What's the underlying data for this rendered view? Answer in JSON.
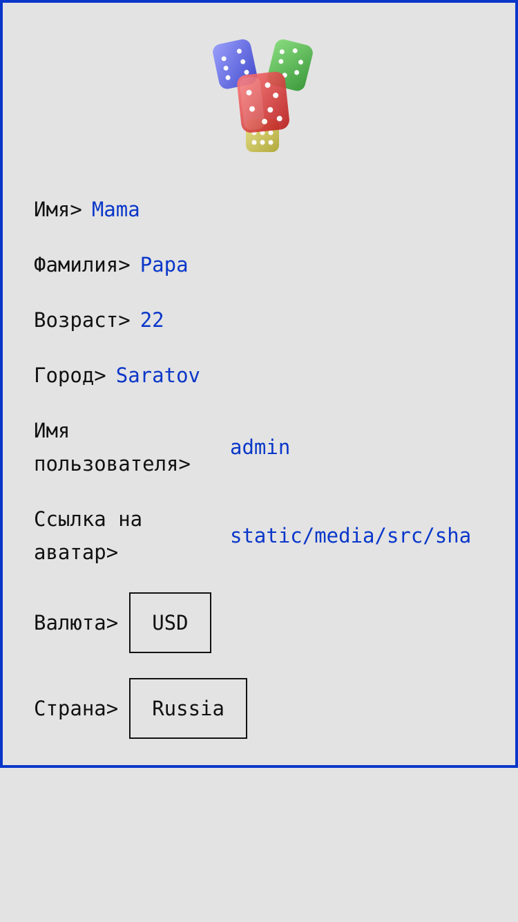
{
  "logo": {
    "icon": "dice-icon"
  },
  "fields": {
    "first_name": {
      "label": "Имя>",
      "value": "Mama"
    },
    "last_name": {
      "label": "Фамилия>",
      "value": "Papa"
    },
    "age": {
      "label": "Возраст>",
      "value": "22"
    },
    "city": {
      "label": "Город>",
      "value": "Saratov"
    },
    "username": {
      "label_line1": "Имя",
      "label_line2": "пользователя>",
      "value": "admin"
    },
    "avatar_link": {
      "label_line1": "Ссылка на",
      "label_line2": "аватар>",
      "value": "static/media/src/sha"
    },
    "currency": {
      "label": "Валюта>",
      "value": "USD"
    },
    "country": {
      "label": "Страна>",
      "value": "Russia"
    }
  },
  "colors": {
    "border": "#0a37c9",
    "value_text": "#0a37c9",
    "background": "#e3e3e3"
  }
}
